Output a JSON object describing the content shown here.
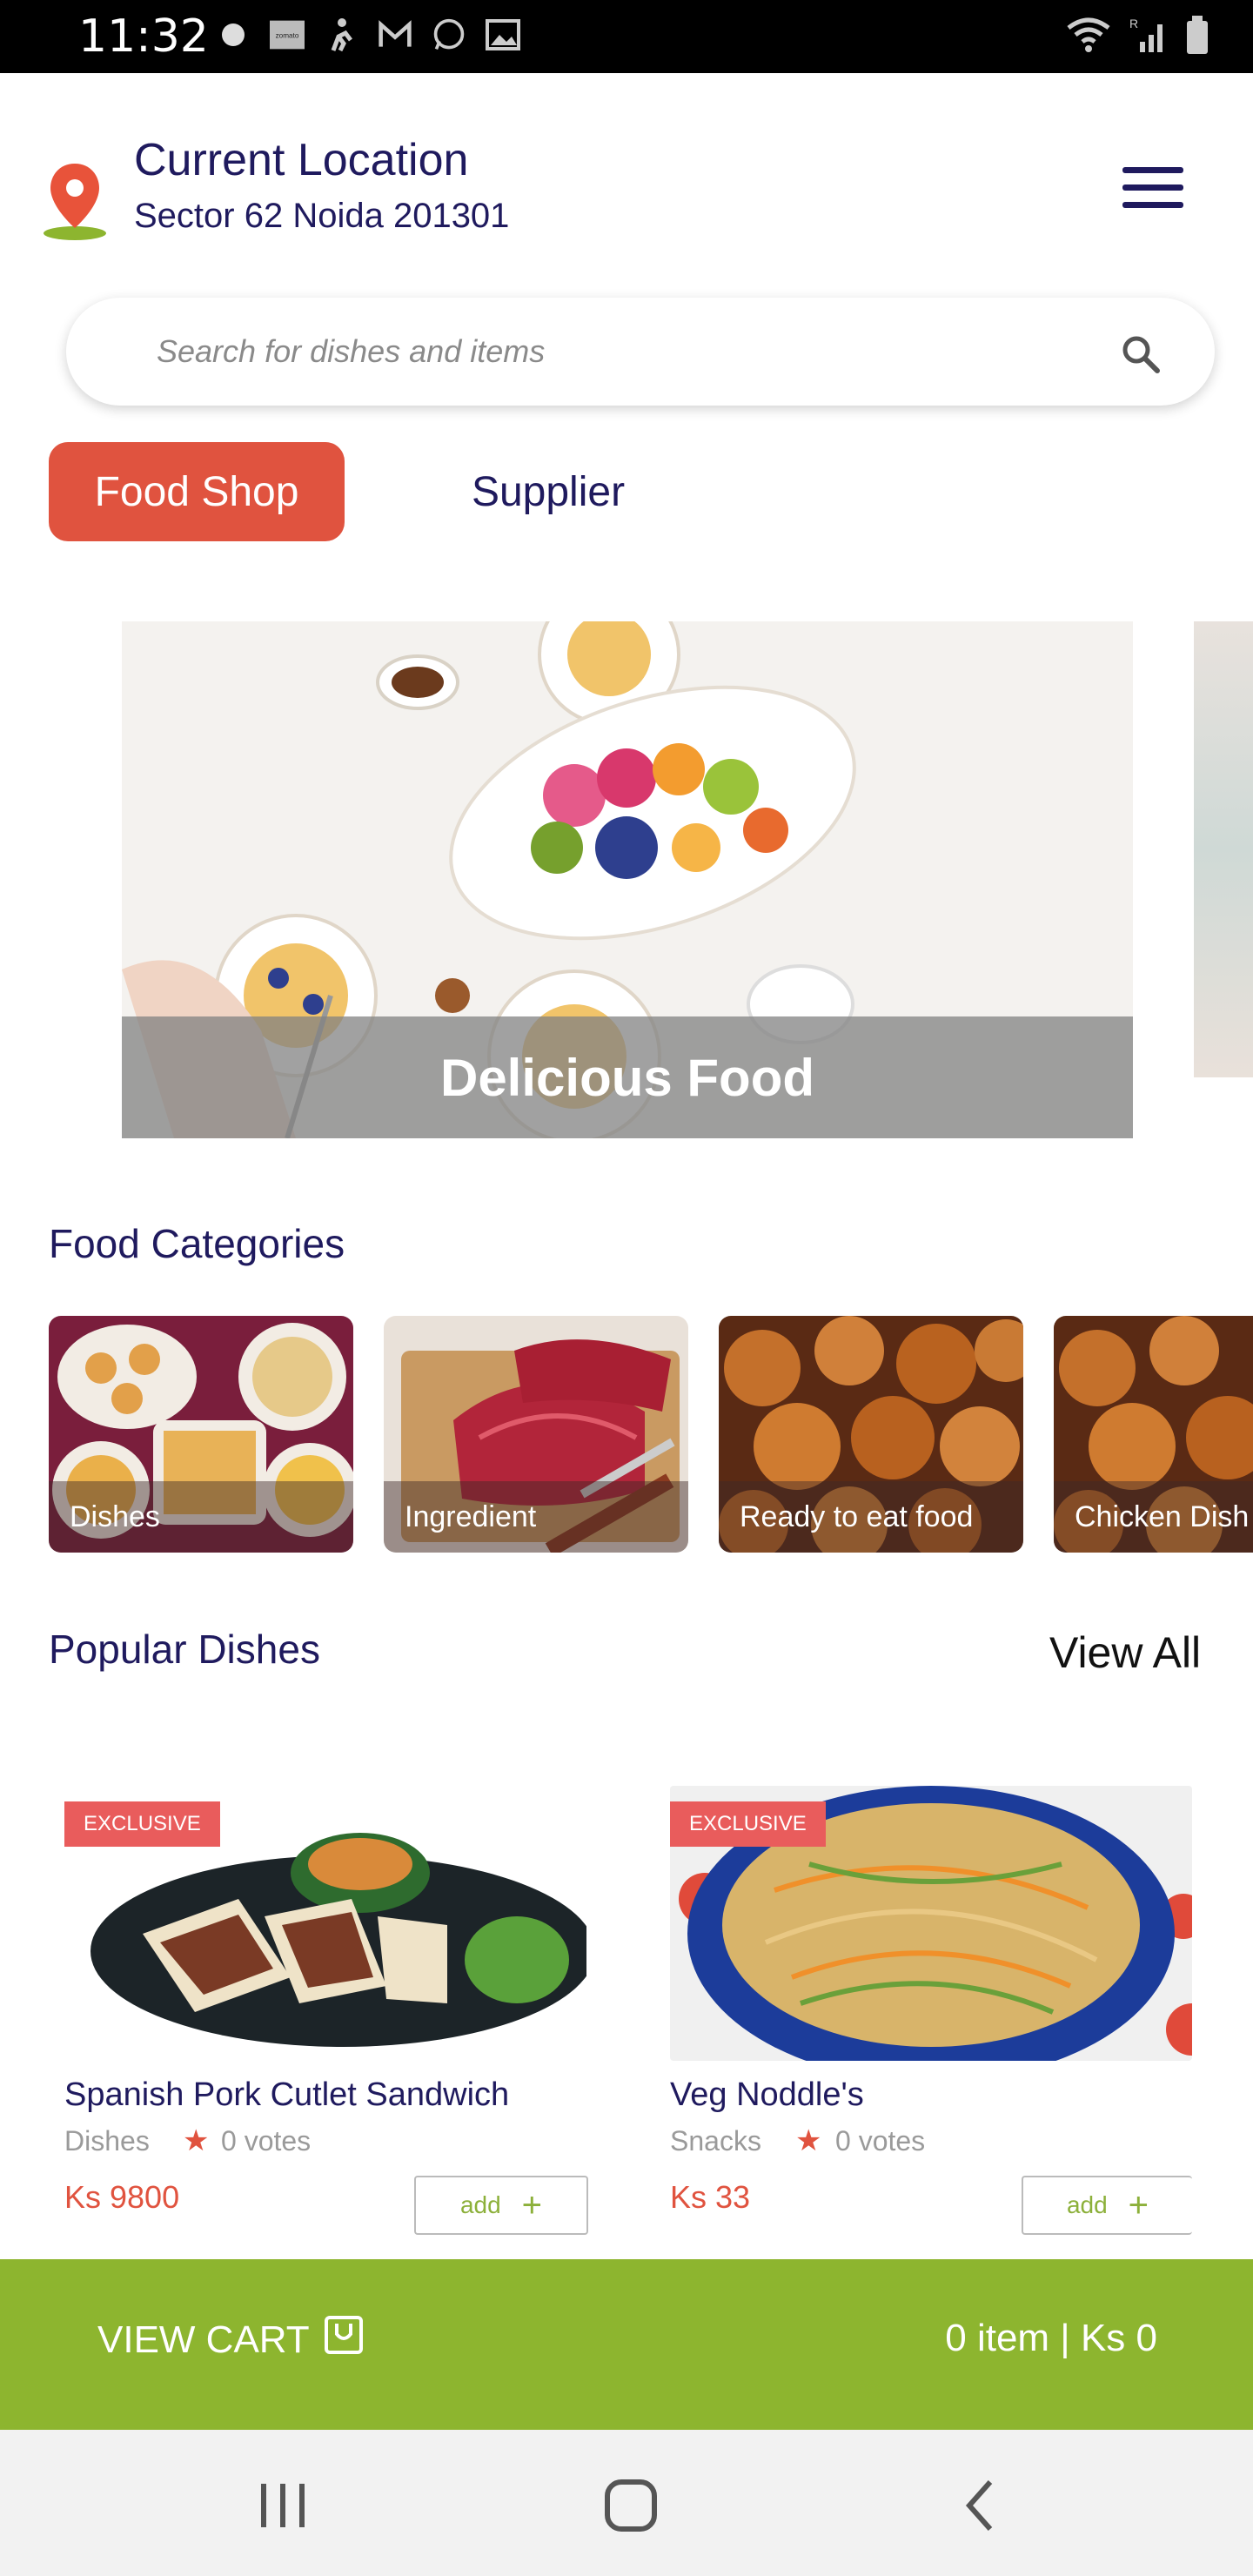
{
  "status_bar": {
    "time": "11:32",
    "left_icons": [
      "brand-icon",
      "zomato-icon",
      "runner-icon",
      "gmail-icon",
      "whatsapp-icon",
      "gallery-icon"
    ],
    "zomato_label": "zomato",
    "right_icons": [
      "wifi-icon",
      "signal-icon",
      "battery-icon"
    ],
    "signal_label": "R"
  },
  "header": {
    "location_title": "Current Location",
    "location_address": "Sector 62 Noida 201301"
  },
  "search": {
    "placeholder": "Search for dishes and items"
  },
  "tabs": [
    {
      "label": "Food Shop",
      "active": true
    },
    {
      "label": "Supplier",
      "active": false
    }
  ],
  "banner": {
    "caption": "Delicious Food"
  },
  "categories": {
    "title": "Food Categories",
    "items": [
      {
        "label": "Dishes"
      },
      {
        "label": "Ingredient"
      },
      {
        "label": "Ready to eat food"
      },
      {
        "label": "Chicken Dish"
      }
    ]
  },
  "popular": {
    "title": "Popular Dishes",
    "view_all": "View All",
    "items": [
      {
        "badge": "EXCLUSIVE",
        "name": "Spanish Pork Cutlet Sandwich",
        "category": "Dishes",
        "votes": "0 votes",
        "price": "Ks 9800",
        "add_label": "add"
      },
      {
        "badge": "EXCLUSIVE",
        "name": "Veg Noddle's",
        "category": "Snacks",
        "votes": "0 votes",
        "price": "Ks 33",
        "add_label": "add"
      }
    ]
  },
  "cart": {
    "label": "VIEW CART",
    "summary": "0 item | Ks 0"
  },
  "colors": {
    "accent": "#e0533f",
    "cart_bar": "#8db52f",
    "text_dark": "#1f1a5e"
  }
}
